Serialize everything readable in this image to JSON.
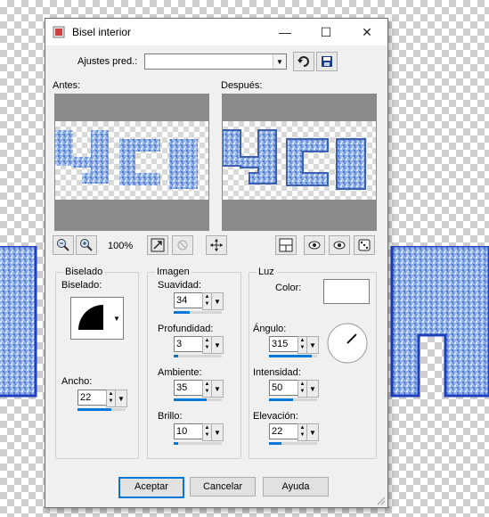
{
  "window": {
    "title": "Bisel interior",
    "minimize_icon": "minimize-icon",
    "maximize_icon": "maximize-icon",
    "close_icon": "close-icon"
  },
  "presets": {
    "label": "Ajustes pred.:",
    "value": ""
  },
  "previews": {
    "before_label": "Antes:",
    "after_label": "Después:"
  },
  "zoom": {
    "value": "100%"
  },
  "biselado": {
    "group_label": "Biselado",
    "shape_label": "Biselado:",
    "width_label": "Ancho:",
    "width_value": "22",
    "width_fraction": 0.7
  },
  "imagen": {
    "group_label": "Imagen",
    "fields": [
      {
        "label": "Suavidad:",
        "value": "34",
        "fraction": 0.34
      },
      {
        "label": "Profundidad:",
        "value": "3",
        "fraction": 0.1
      },
      {
        "label": "Ambiente:",
        "value": "35",
        "fraction": 0.68
      },
      {
        "label": "Brillo:",
        "value": "10",
        "fraction": 0.1
      }
    ]
  },
  "luz": {
    "group_label": "Luz",
    "color_label": "Color:",
    "color_value": "#ffffff",
    "fields": [
      {
        "label": "Ángulo:",
        "value": "315",
        "fraction": 0.88
      },
      {
        "label": "Intensidad:",
        "value": "50",
        "fraction": 0.5
      },
      {
        "label": "Elevación:",
        "value": "22",
        "fraction": 0.25
      }
    ]
  },
  "buttons": {
    "ok": "Aceptar",
    "cancel": "Cancelar",
    "help": "Ayuda"
  },
  "colors": {
    "accent": "#0078d7",
    "text_blue": "#5b86d6",
    "text_outline": "#2244bb"
  }
}
